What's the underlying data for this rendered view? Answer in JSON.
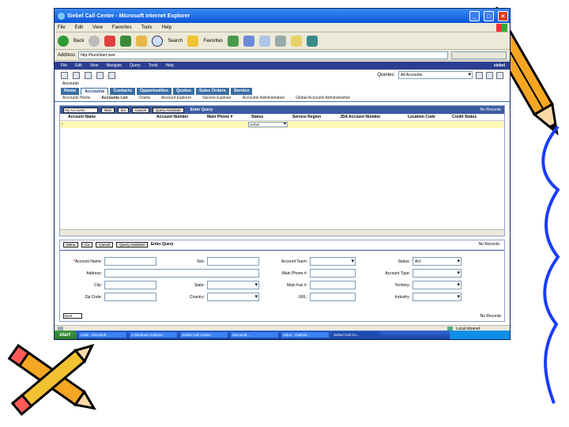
{
  "ie": {
    "title": "Siebel Call Center - Microsoft Internet Explorer",
    "menu": [
      "File",
      "Edit",
      "View",
      "Favorites",
      "Tools",
      "Help"
    ],
    "toolbar": {
      "back": "Back",
      "search": "Search",
      "favorites": "Favorites"
    },
    "address_label": "Address",
    "address_value": "http://hunt/start.swe",
    "go_text": ""
  },
  "siebel": {
    "menu": [
      "File",
      "Edit",
      "View",
      "Navigate",
      "Query",
      "Tools",
      "Help"
    ],
    "logo": "siebel",
    "queries_label": "Queries:",
    "queries_value": "All Accounts",
    "breadcrumb": "Accounts",
    "tabs": [
      "Home",
      "Accounts",
      "Contacts",
      "Opportunities",
      "Quotes",
      "Sales Orders",
      "Service"
    ],
    "active_tab": "Accounts",
    "subnav": [
      "Accounts Home",
      "Accounts List",
      "Charts",
      "Account Explorer",
      "Service Explorer",
      "Accounts Administration",
      "Global Accounts Administration"
    ],
    "list": {
      "visibility": "My Accounts",
      "new_btn": "New",
      "go_btn": "Go",
      "cancel_btn": "Cancel",
      "query_btn": "Query Assistant",
      "title": "Enter Query",
      "records": "No Records",
      "columns": [
        "Account Name",
        "Account Number",
        "Main Phone #",
        "Status",
        "Service Region",
        "JDA Account Number",
        "Location Code",
        "Credit Status"
      ],
      "status_value": "Active"
    },
    "form": {
      "menu_btn": "Menu",
      "go_btn": "Go",
      "cancel_btn": "Cancel",
      "query_btn": "Query Assistant",
      "title": "Enter Query",
      "records": "No Records",
      "fields": {
        "account_name": "Account Name:",
        "site": "Site:",
        "account_team": "Account Team:",
        "status": "Status:",
        "status_value": "Act",
        "address": "Address:",
        "main_phone": "Main Phone #:",
        "account_type": "Account Type:",
        "city": "City:",
        "state": "State:",
        "main_fax": "Main Fax #:",
        "territory": "Territory:",
        "zip": "Zip Code:",
        "country": "Country:",
        "url": "URL:",
        "industry": "Industry:"
      },
      "next_btn": "Next",
      "records_bottom": "No Records"
    }
  },
  "statusbar": {
    "zone": "Local intranet"
  },
  "taskbar": {
    "start": "start",
    "tasks": [
      "Calls - Microsoft...",
      "2 Windows Explorer",
      "Siebel Call Center...",
      "Microsoft...",
      "Inbox - Outlook..."
    ],
    "active_task": "Siebel Call Ce...",
    "tray": ""
  },
  "colors": {
    "ie_title": "#0a54d8",
    "siebel_nav": "#2c3e8f",
    "tab": "#3a6ea5",
    "applet_header": "#3a5ba0",
    "query_row": "#fff7b8",
    "taskbar": "#1941a5",
    "start": "#2b7a2b"
  }
}
